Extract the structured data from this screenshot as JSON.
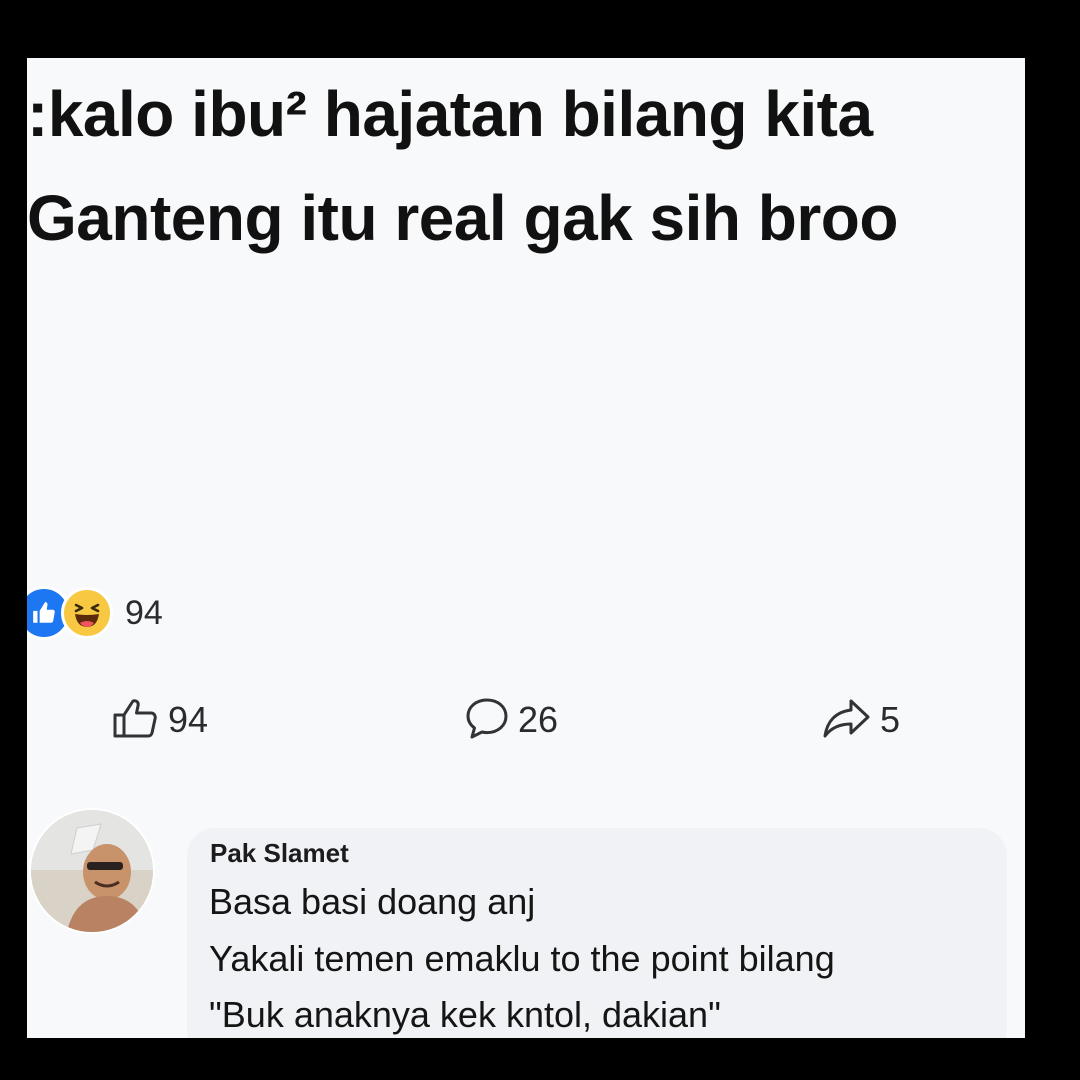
{
  "post": {
    "line1": ":kalo ibu² hajatan bilang kita",
    "line2": "Ganteng itu real gak sih broo"
  },
  "reactions": {
    "icons": [
      "like-icon",
      "haha-icon"
    ],
    "count": "94"
  },
  "actions": {
    "like_count": "94",
    "comment_count": "26",
    "share_count": "5"
  },
  "comment": {
    "author": "Pak Slamet",
    "lines": [
      "Basa basi doang anj",
      "Yakali temen emaklu to the point bilang",
      "\"Buk anaknya kek kntol, dakian\""
    ]
  },
  "colors": {
    "like_blue": "#1d76f2",
    "haha_yellow": "#f8c842",
    "background": "#f7f9fb",
    "frame": "#000000"
  }
}
